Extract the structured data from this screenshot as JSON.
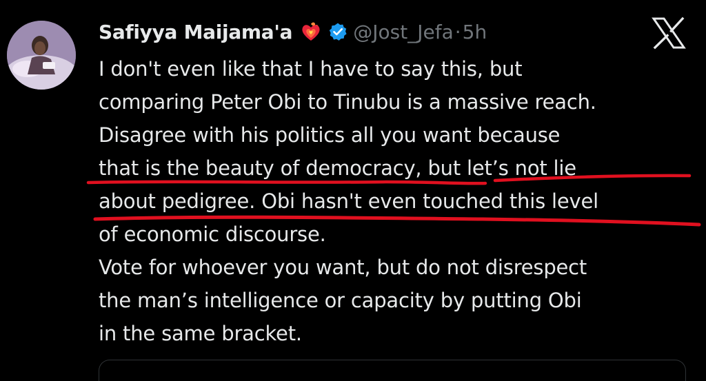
{
  "tweet": {
    "author_name": "Safiyya Maijama'a",
    "handle": "@Jost_Jefa",
    "separator": "·",
    "time": "5h",
    "icons": {
      "emoji": "heart-on-fire-icon",
      "verified": "verified-badge-icon",
      "platform": "x-logo-icon"
    },
    "body_lines": [
      "I don't even like that I have to say this, but",
      "comparing Peter Obi to Tinubu is a massive reach.",
      "Disagree with his politics all you want because",
      "that is the beauty of democracy, but let’s not lie",
      "about pedigree. Obi hasn't even touched this level",
      "of economic discourse.",
      "Vote for whoever you want, but do not disrespect",
      "the man’s intelligence or capacity by putting Obi",
      "in the same bracket."
    ]
  },
  "colors": {
    "background": "#000000",
    "text": "#e7e9ea",
    "muted": "#71767b",
    "verified": "#1d9bf0",
    "annotation": "#e0101f"
  }
}
